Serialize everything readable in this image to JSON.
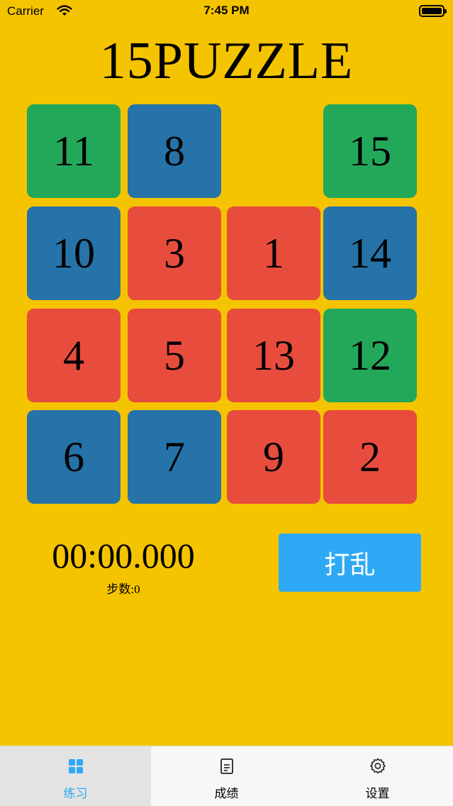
{
  "status_bar": {
    "carrier": "Carrier",
    "time": "7:45 PM"
  },
  "title": "15PUZZLE",
  "colors": {
    "background": "#F5C400",
    "green": "#23A85A",
    "blue": "#2573A8",
    "red": "#E84C3D",
    "accent": "#2EA9F5"
  },
  "board": {
    "rows": [
      [
        {
          "value": "11",
          "color": "green"
        },
        {
          "value": "8",
          "color": "blue"
        },
        {
          "value": "",
          "color": "empty"
        },
        {
          "value": "15",
          "color": "green"
        }
      ],
      [
        {
          "value": "10",
          "color": "blue"
        },
        {
          "value": "3",
          "color": "red"
        },
        {
          "value": "1",
          "color": "red"
        },
        {
          "value": "14",
          "color": "blue"
        }
      ],
      [
        {
          "value": "4",
          "color": "red"
        },
        {
          "value": "5",
          "color": "red"
        },
        {
          "value": "13",
          "color": "red"
        },
        {
          "value": "12",
          "color": "green"
        }
      ],
      [
        {
          "value": "6",
          "color": "blue"
        },
        {
          "value": "7",
          "color": "blue"
        },
        {
          "value": "9",
          "color": "red"
        },
        {
          "value": "2",
          "color": "red"
        }
      ]
    ]
  },
  "timer": "00:00.000",
  "steps": "步数:0",
  "shuffle_label": "打乱",
  "tabs": [
    {
      "label": "练习",
      "icon": "grid-icon",
      "active": true
    },
    {
      "label": "成绩",
      "icon": "document-icon",
      "active": false
    },
    {
      "label": "设置",
      "icon": "gear-icon",
      "active": false
    }
  ]
}
